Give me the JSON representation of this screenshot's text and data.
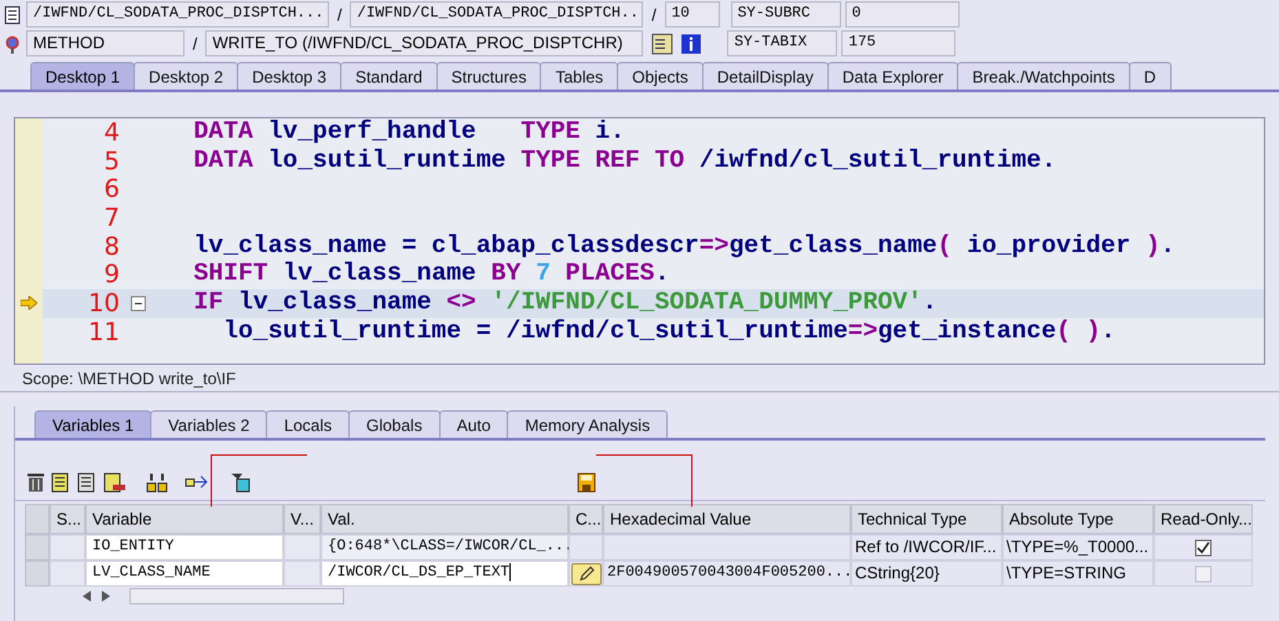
{
  "header": {
    "rows": [
      {
        "kind": "program",
        "fields": [
          "/IWFND/CL_SODATA_PROC_DISPTCH...",
          "/IWFND/CL_SODATA_PROC_DISPTCH...",
          "10"
        ],
        "seps": [
          "/",
          "/"
        ],
        "sysvar": "SY-SUBRC",
        "sysval": "0"
      },
      {
        "kind": "method",
        "fields": [
          "METHOD",
          "WRITE_TO (/IWFND/CL_SODATA_PROC_DISPTCHR)"
        ],
        "seps": [
          "/"
        ],
        "sysvar": "SY-TABIX",
        "sysval": "175"
      }
    ]
  },
  "desktop_tabs": [
    {
      "label": "Desktop 1",
      "selected": true
    },
    {
      "label": "Desktop 2",
      "selected": false
    },
    {
      "label": "Desktop 3",
      "selected": false
    },
    {
      "label": "Standard",
      "selected": false
    },
    {
      "label": "Structures",
      "selected": false
    },
    {
      "label": "Tables",
      "selected": false
    },
    {
      "label": "Objects",
      "selected": false
    },
    {
      "label": "DetailDisplay",
      "selected": false
    },
    {
      "label": "Data Explorer",
      "selected": false
    },
    {
      "label": "Break./Watchpoints",
      "selected": false
    },
    {
      "label": "D",
      "selected": false
    }
  ],
  "code": {
    "lines": [
      {
        "number": "4",
        "current": false,
        "fold": false,
        "tokens": [
          {
            "kind": "keyword",
            "text": "  DATA "
          },
          {
            "kind": "ident",
            "text": "lv_perf_handle   "
          },
          {
            "kind": "keyword",
            "text": "TYPE "
          },
          {
            "kind": "ident",
            "text": "i."
          }
        ]
      },
      {
        "number": "5",
        "current": false,
        "fold": false,
        "tokens": [
          {
            "kind": "keyword",
            "text": "  DATA "
          },
          {
            "kind": "ident",
            "text": "lo_sutil_runtime "
          },
          {
            "kind": "keyword",
            "text": "TYPE REF TO "
          },
          {
            "kind": "ident",
            "text": "/iwfnd/cl_sutil_runtime."
          }
        ]
      },
      {
        "number": "6",
        "current": false,
        "fold": false
      },
      {
        "number": "7",
        "current": false,
        "fold": false
      },
      {
        "number": "8",
        "current": false,
        "fold": false,
        "tokens": [
          {
            "kind": "ident",
            "text": "  lv_class_name = cl_abap_classdescr"
          },
          {
            "kind": "op",
            "text": "=>"
          },
          {
            "kind": "ident",
            "text": "get_class_name"
          },
          {
            "kind": "op",
            "text": "("
          },
          {
            "kind": "ident",
            "text": " io_provider "
          },
          {
            "kind": "op",
            "text": ")"
          },
          {
            "kind": "ident",
            "text": "."
          }
        ]
      },
      {
        "number": "9",
        "current": false,
        "fold": false,
        "tokens": [
          {
            "kind": "keyword",
            "text": "  SHIFT "
          },
          {
            "kind": "ident",
            "text": "lv_class_name "
          },
          {
            "kind": "keyword",
            "text": "BY "
          },
          {
            "kind": "number",
            "text": "7 "
          },
          {
            "kind": "keyword",
            "text": "PLACES"
          },
          {
            "kind": "ident",
            "text": "."
          }
        ]
      },
      {
        "number": "10",
        "current": true,
        "fold": true,
        "tokens": [
          {
            "kind": "keyword",
            "text": "  IF "
          },
          {
            "kind": "ident",
            "text": "lv_class_name "
          },
          {
            "kind": "op",
            "text": "<> "
          },
          {
            "kind": "string",
            "text": "'/IWFND/CL_SODATA_DUMMY_PROV'"
          },
          {
            "kind": "ident",
            "text": "."
          }
        ]
      },
      {
        "number": "11",
        "current": false,
        "fold": false,
        "tokens": [
          {
            "kind": "ident",
            "text": "    lo_sutil_runtime = /iwfnd/cl_sutil_runtime"
          },
          {
            "kind": "op",
            "text": "=>"
          },
          {
            "kind": "ident",
            "text": "get_instance"
          },
          {
            "kind": "op",
            "text": "( )"
          },
          {
            "kind": "ident",
            "text": "."
          }
        ]
      }
    ]
  },
  "scope": "Scope: \\METHOD write_to\\IF",
  "variable_tabs": [
    {
      "label": "Variables 1",
      "selected": true
    },
    {
      "label": "Variables 2",
      "selected": false
    },
    {
      "label": "Locals",
      "selected": false
    },
    {
      "label": "Globals",
      "selected": false
    },
    {
      "label": "Auto",
      "selected": false
    },
    {
      "label": "Memory Analysis",
      "selected": false
    }
  ],
  "table": {
    "columns": [
      "S...",
      "Variable",
      "V...",
      "Val.",
      "C...",
      "Hexadecimal Value",
      "Technical Type",
      "Absolute Type",
      "Read-Only..."
    ],
    "rows": [
      {
        "variable": "IO_ENTITY",
        "value": "{O:648*\\CLASS=/IWCOR/CL_...",
        "editable": false,
        "hex": "",
        "technical_type": "Ref to /IWCOR/IF...",
        "absolute_type": "\\TYPE=%_T0000...",
        "read_only": true
      },
      {
        "variable": "LV_CLASS_NAME",
        "value": "/IWCOR/CL_DS_EP_TEXT",
        "editable": true,
        "hex": "2F004900570043004F005200...",
        "technical_type": "CString{20}",
        "absolute_type": "\\TYPE=STRING",
        "read_only": false
      }
    ]
  }
}
